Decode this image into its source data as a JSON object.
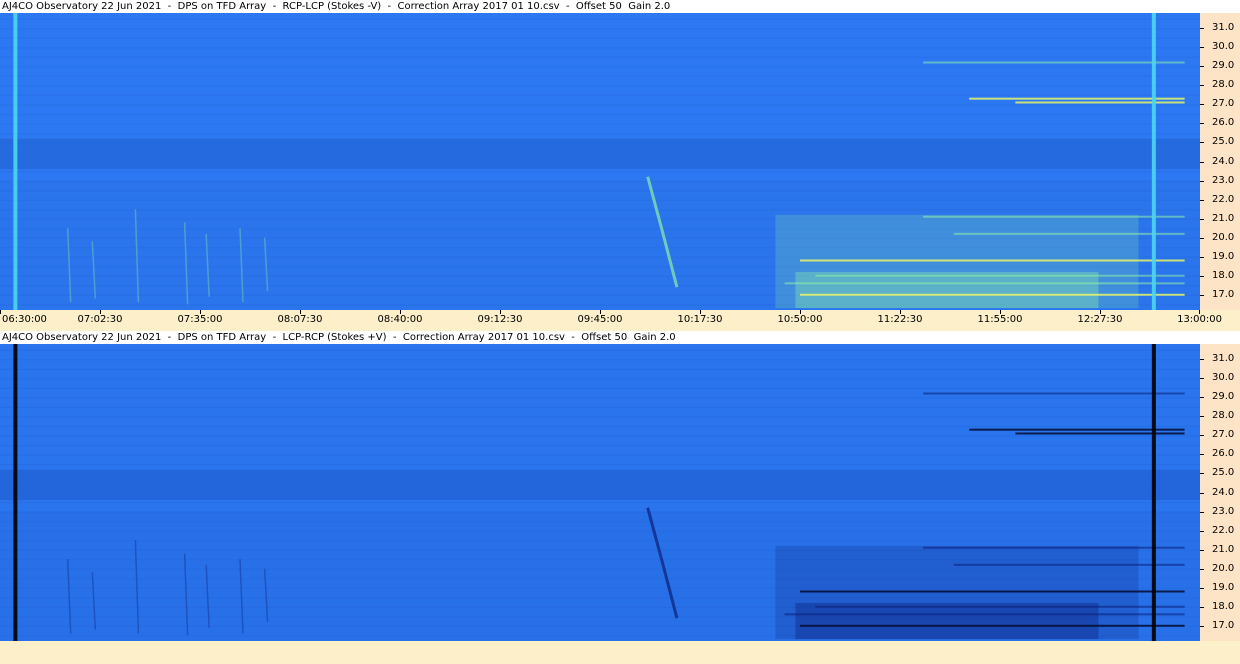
{
  "panels": [
    {
      "title": "AJ4CO Observatory 22 Jun 2021  -  DPS on TFD Array  -  RCP-LCP (Stokes -V)  -  Correction Array 2017 01 10.csv  -  Offset 50  Gain 2.0",
      "show_x_labels": true,
      "base_color": "#2c78f2",
      "band_color": "#2467da",
      "emission_color": "#8ff0a6",
      "strong_color": "#e6f56a",
      "line_color": "#4ad7f0"
    },
    {
      "title": "AJ4CO Observatory 22 Jun 2021  -  DPS on TFD Array  -  LCP-RCP (Stokes +V)  -  Correction Array 2017 01 10.csv  -  Offset 50  Gain 2.0",
      "show_x_labels": false,
      "base_color": "#2a75ee",
      "band_color": "#2262d6",
      "emission_color": "#0b1e78",
      "strong_color": "#050c30",
      "line_color": "#000000"
    }
  ],
  "chart_data": {
    "type": "heatmap",
    "x_axis": {
      "unit": "UTC time",
      "range": [
        "06:30:00",
        "13:00:00"
      ],
      "tick_labels": [
        "06:30:00",
        "07:02:30",
        "07:35:00",
        "08:07:30",
        "08:40:00",
        "09:12:30",
        "09:45:00",
        "10:17:30",
        "10:50:00",
        "11:22:30",
        "11:55:00",
        "12:27:30",
        "13:00:00"
      ]
    },
    "y_axis": {
      "unit": "MHz",
      "range": [
        16.2,
        31.8
      ],
      "tick_labels": [
        "31.0",
        "30.0",
        "29.0",
        "28.0",
        "27.0",
        "26.0",
        "25.0",
        "24.0",
        "23.0",
        "22.0",
        "21.0",
        "20.0",
        "19.0",
        "18.0",
        "17.0"
      ]
    },
    "features": {
      "vertical_line_times": [
        "06:35:00",
        "12:45:00"
      ],
      "quiet_band_mhz": [
        23.6,
        25.2
      ],
      "faint_bursts": [
        {
          "time": "06:52:00",
          "low_mhz": 16.6,
          "high_mhz": 20.5
        },
        {
          "time": "07:00:00",
          "low_mhz": 16.8,
          "high_mhz": 19.8
        },
        {
          "time": "07:14:00",
          "low_mhz": 16.6,
          "high_mhz": 21.5
        },
        {
          "time": "07:30:00",
          "low_mhz": 16.5,
          "high_mhz": 20.8
        },
        {
          "time": "07:37:00",
          "low_mhz": 16.9,
          "high_mhz": 20.2
        },
        {
          "time": "07:48:00",
          "low_mhz": 16.6,
          "high_mhz": 20.5
        },
        {
          "time": "07:56:00",
          "low_mhz": 17.2,
          "high_mhz": 20.0
        }
      ],
      "drifting_burst": [
        {
          "time": "10:00:30",
          "mhz": 23.2
        },
        {
          "time": "10:05:00",
          "mhz": 20.5
        },
        {
          "time": "10:10:00",
          "mhz": 17.4
        }
      ],
      "emission_region": {
        "start": "10:42:00",
        "end": "12:40:00",
        "low_mhz": 16.3,
        "high_mhz": 21.2
      },
      "narrowband_lines": [
        {
          "start": "12:00:00",
          "end": "12:55:00",
          "mhz": 27.1,
          "strong": true
        },
        {
          "start": "11:45:00",
          "end": "12:55:00",
          "mhz": 27.3,
          "strong": true
        },
        {
          "start": "11:30:00",
          "end": "12:55:00",
          "mhz": 29.2,
          "strong": false
        },
        {
          "start": "11:30:00",
          "end": "12:55:00",
          "mhz": 21.1,
          "strong": false
        },
        {
          "start": "11:40:00",
          "end": "12:55:00",
          "mhz": 20.2,
          "strong": false
        },
        {
          "start": "10:50:00",
          "end": "12:55:00",
          "mhz": 18.8,
          "strong": true
        },
        {
          "start": "10:55:00",
          "end": "12:55:00",
          "mhz": 18.0,
          "strong": false
        },
        {
          "start": "10:45:00",
          "end": "12:55:00",
          "mhz": 17.6,
          "strong": false
        },
        {
          "start": "10:50:00",
          "end": "12:55:00",
          "mhz": 17.0,
          "strong": true
        }
      ]
    }
  }
}
